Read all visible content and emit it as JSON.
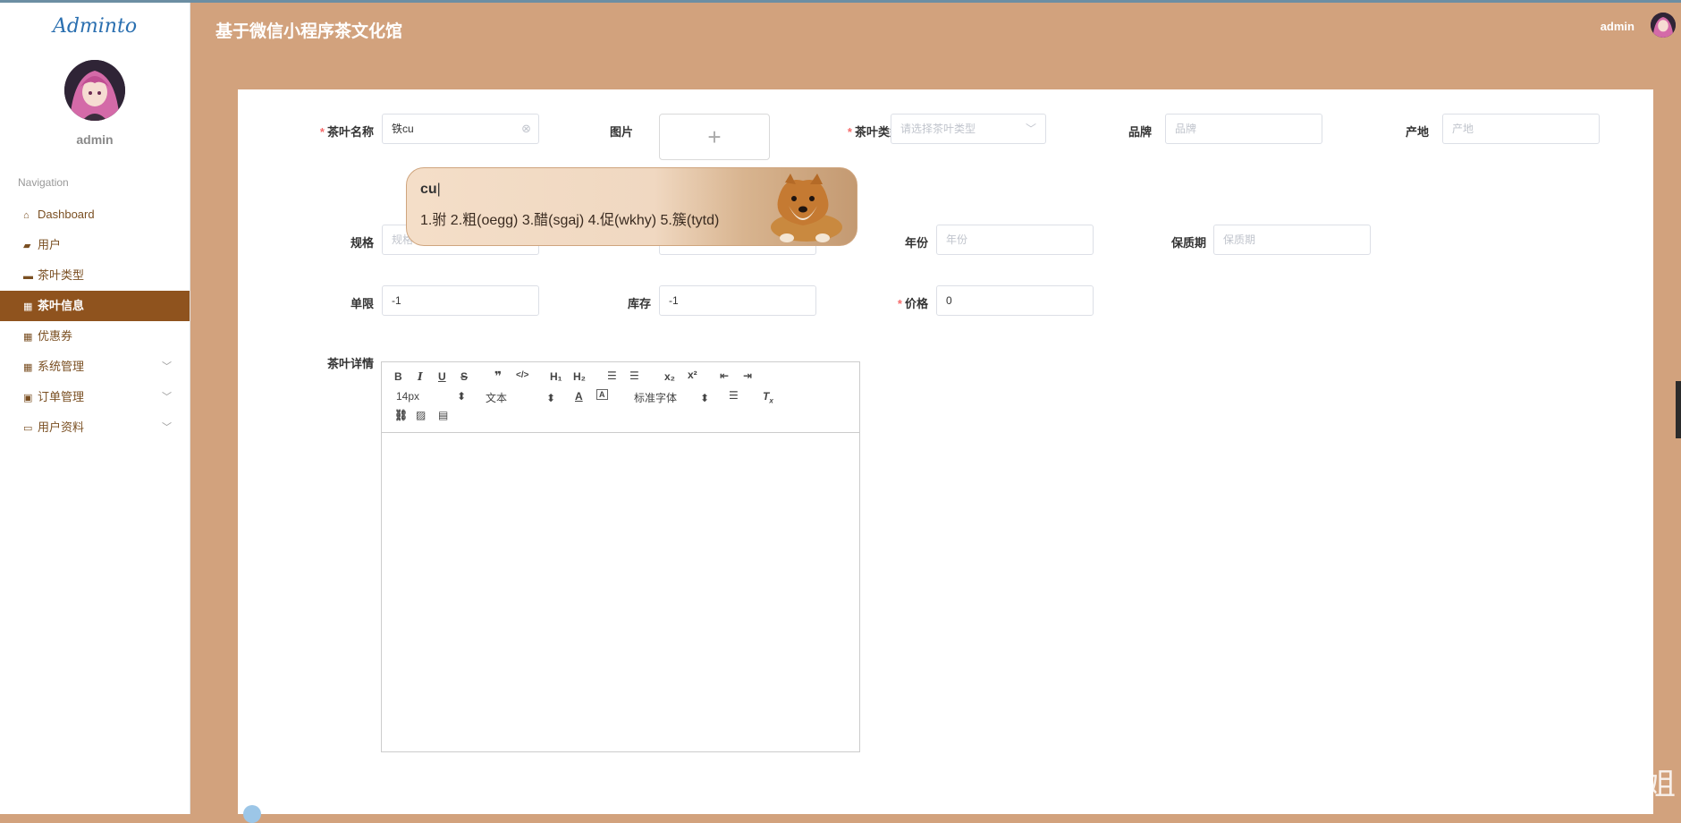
{
  "header": {
    "app_title": "基于微信小程序茶文化馆",
    "user": "admin"
  },
  "sidebar": {
    "logo": "Adminto",
    "user": "admin",
    "nav_heading": "Navigation",
    "items": [
      {
        "label": "Dashboard",
        "icon": "home-icon"
      },
      {
        "label": "用户",
        "icon": "briefcase-icon"
      },
      {
        "label": "茶叶类型",
        "icon": "ticket-icon"
      },
      {
        "label": "茶叶信息",
        "icon": "grid-icon",
        "active": true
      },
      {
        "label": "优惠券",
        "icon": "grid-icon"
      },
      {
        "label": "系统管理",
        "icon": "grid-icon",
        "has_children": true
      },
      {
        "label": "订单管理",
        "icon": "monitor-icon",
        "has_children": true
      },
      {
        "label": "用户资料",
        "icon": "card-icon",
        "has_children": true
      }
    ]
  },
  "form": {
    "tea_name": {
      "label": "茶叶名称",
      "value": "铁cu"
    },
    "image": {
      "label": "图片"
    },
    "tea_type": {
      "label": "茶叶类型",
      "placeholder": "请选择茶叶类型"
    },
    "brand": {
      "label": "品牌",
      "placeholder": "品牌"
    },
    "origin": {
      "label": "产地",
      "placeholder": "产地"
    },
    "spec": {
      "label": "规格",
      "placeholder": "规格"
    },
    "year": {
      "label": "年份",
      "placeholder": "年份"
    },
    "shelf_life": {
      "label": "保质期",
      "placeholder": "保质期"
    },
    "limit": {
      "label": "单限",
      "value": "-1"
    },
    "stock": {
      "label": "库存",
      "value": "-1"
    },
    "price": {
      "label": "价格",
      "value": "0"
    },
    "details": {
      "label": "茶叶详情"
    }
  },
  "editor": {
    "font_size": "14px",
    "text_style": "文本",
    "font_family": "标准字体"
  },
  "ime": {
    "composition": "cu",
    "candidates": "1.驸  2.粗(oegg)  3.醋(sgaj)  4.促(wkhy)  5.簇(tytd)"
  },
  "watermark": "CSDN @茹茹学姐"
}
